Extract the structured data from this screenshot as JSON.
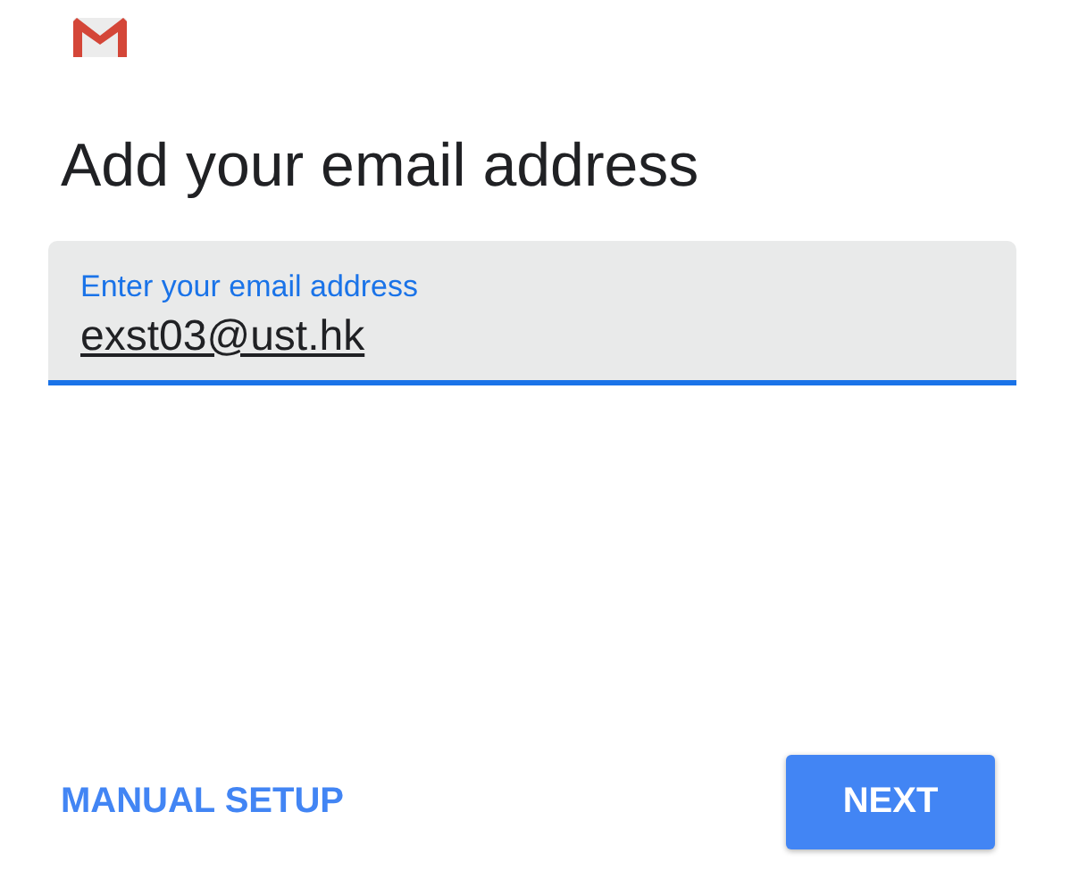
{
  "title": "Add your email address",
  "email_field": {
    "label": "Enter your email address",
    "value": "exst03@ust.hk",
    "focused": true
  },
  "buttons": [
    {
      "kind": "text",
      "label": "MANUAL SETUP"
    },
    {
      "kind": "raised",
      "label": "NEXT"
    }
  ]
}
